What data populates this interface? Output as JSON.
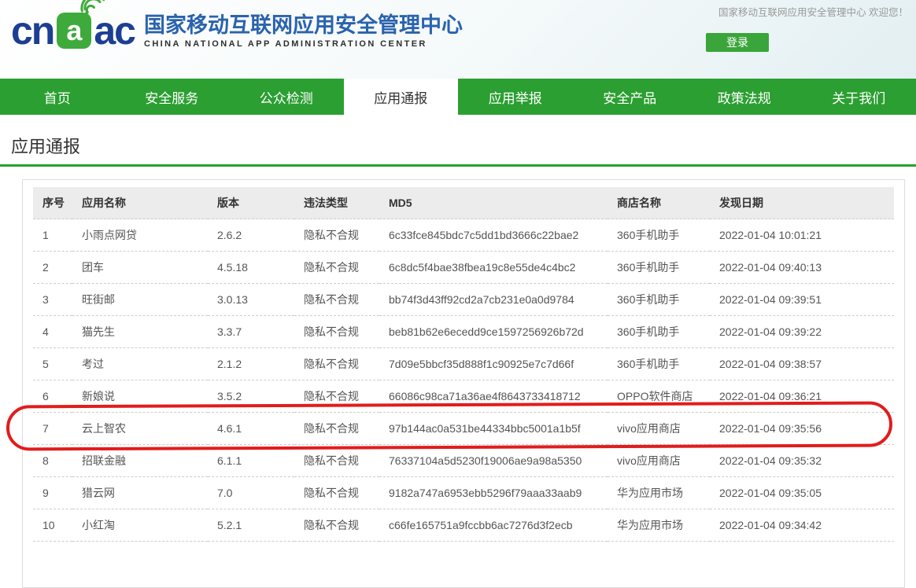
{
  "header": {
    "welcome_text": "国家移动互联网应用安全管理中心 欢迎您！",
    "login_label": "登录"
  },
  "logo": {
    "letters_left": "cn",
    "box_letter": "a",
    "letters_right": "ac",
    "title_cn": "国家移动互联网应用安全管理中心",
    "title_en": "CHINA NATIONAL APP ADMINISTRATION CENTER"
  },
  "nav": {
    "items": [
      {
        "label": "首页",
        "active": false
      },
      {
        "label": "安全服务",
        "active": false
      },
      {
        "label": "公众检测",
        "active": false
      },
      {
        "label": "应用通报",
        "active": true
      },
      {
        "label": "应用举报",
        "active": false
      },
      {
        "label": "安全产品",
        "active": false
      },
      {
        "label": "政策法规",
        "active": false
      },
      {
        "label": "关于我们",
        "active": false
      }
    ]
  },
  "section": {
    "title": "应用通报"
  },
  "table": {
    "columns": [
      "序号",
      "应用名称",
      "版本",
      "违法类型",
      "MD5",
      "商店名称",
      "发现日期"
    ],
    "rows": [
      [
        "1",
        "小雨点网贷",
        "2.6.2",
        "隐私不合规",
        "6c33fce845bdc7c5dd1bd3666c22bae2",
        "360手机助手",
        "2022-01-04 10:01:21"
      ],
      [
        "2",
        "团车",
        "4.5.18",
        "隐私不合规",
        "6c8dc5f4bae38fbea19c8e55de4c4bc2",
        "360手机助手",
        "2022-01-04 09:40:13"
      ],
      [
        "3",
        "旺街邮",
        "3.0.13",
        "隐私不合规",
        "bb74f3d43ff92cd2a7cb231e0a0d9784",
        "360手机助手",
        "2022-01-04 09:39:51"
      ],
      [
        "4",
        "猫先生",
        "3.3.7",
        "隐私不合规",
        "beb81b62e6ecedd9ce1597256926b72d",
        "360手机助手",
        "2022-01-04 09:39:22"
      ],
      [
        "5",
        "考过",
        "2.1.2",
        "隐私不合规",
        "7d09e5bbcf35d888f1c90925e7c7d66f",
        "360手机助手",
        "2022-01-04 09:38:57"
      ],
      [
        "6",
        "新娘说",
        "3.5.2",
        "隐私不合规",
        "66086c98ca71a36ae4f8643733418712",
        "OPPO软件商店",
        "2022-01-04 09:36:21"
      ],
      [
        "7",
        "云上智农",
        "4.6.1",
        "隐私不合规",
        "97b144ac0a531be44334bbc5001a1b5f",
        "vivo应用商店",
        "2022-01-04 09:35:56"
      ],
      [
        "8",
        "招联金融",
        "6.1.1",
        "隐私不合规",
        "76337104a5d5230f19006ae9a98a5350",
        "vivo应用商店",
        "2022-01-04 09:35:32"
      ],
      [
        "9",
        "猎云网",
        "7.0",
        "隐私不合规",
        "9182a747a6953ebb5296f79aaa33aab9",
        "华为应用市场",
        "2022-01-04 09:35:05"
      ],
      [
        "10",
        "小红淘",
        "5.2.1",
        "隐私不合规",
        "c66fe165751a9fccbb6ac7276d3f2ecb",
        "华为应用市场",
        "2022-01-04 09:34:42"
      ]
    ]
  },
  "annotation": {
    "type": "hand-drawn-red-circle",
    "highlighted_row_number": "7",
    "color": "#e21c1c"
  },
  "colors": {
    "nav_green": "#2b9f31",
    "logo_green": "#3faa3c",
    "logo_blue": "#1c3f94",
    "title_blue": "#2a63ad",
    "button_green": "#3aa53a"
  }
}
